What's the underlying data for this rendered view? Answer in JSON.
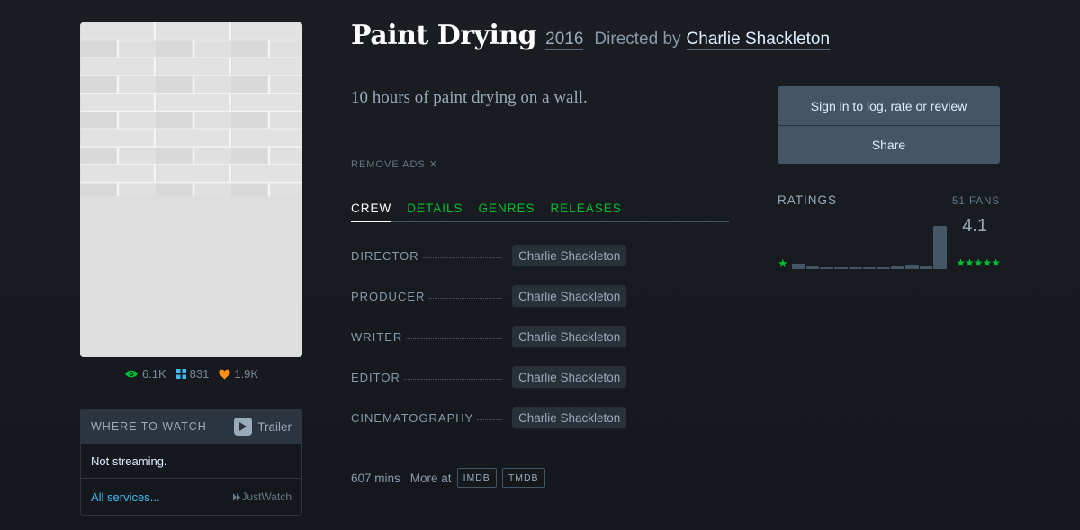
{
  "film": {
    "title": "Paint Drying",
    "year": "2016",
    "directed_by": "Directed by",
    "director": "Charlie Shackleton",
    "tagline": "10 hours of paint drying on a wall."
  },
  "stats": {
    "watched": "6.1K",
    "lists": "831",
    "likes": "1.9K"
  },
  "where_to_watch": {
    "title": "WHERE TO WATCH",
    "trailer": "Trailer",
    "status": "Not streaming.",
    "all_services": "All services...",
    "provider": "JustWatch"
  },
  "remove_ads": "REMOVE ADS ✕",
  "tabs": [
    {
      "label": "CREW",
      "active": true
    },
    {
      "label": "DETAILS",
      "active": false
    },
    {
      "label": "GENRES",
      "active": false
    },
    {
      "label": "RELEASES",
      "active": false
    }
  ],
  "crew": [
    {
      "role": "DIRECTOR",
      "person": "Charlie Shackleton"
    },
    {
      "role": "PRODUCER",
      "person": "Charlie Shackleton"
    },
    {
      "role": "WRITER",
      "person": "Charlie Shackleton"
    },
    {
      "role": "EDITOR",
      "person": "Charlie Shackleton"
    },
    {
      "role": "CINEMATOGRAPHY",
      "person": "Charlie Shackleton"
    }
  ],
  "footer_meta": {
    "runtime": "607 mins",
    "more_at": "More at",
    "imdb": "IMDB",
    "tmdb": "TMDB"
  },
  "actions": {
    "sign_in": "Sign in to log, rate or review",
    "share": "Share"
  },
  "ratings": {
    "title": "RATINGS",
    "fans": "51 FANS",
    "average": "4.1",
    "min_stars": "★",
    "max_stars": "★★★★★",
    "histogram": [
      0.12,
      0.06,
      0.04,
      0.04,
      0.04,
      0.04,
      0.05,
      0.06,
      0.08,
      0.07,
      1.0
    ]
  },
  "colors": {
    "accent_green": "#00c030",
    "link_blue": "#40bcf4",
    "likes_orange": "#ff9010",
    "background": "#14181c"
  }
}
